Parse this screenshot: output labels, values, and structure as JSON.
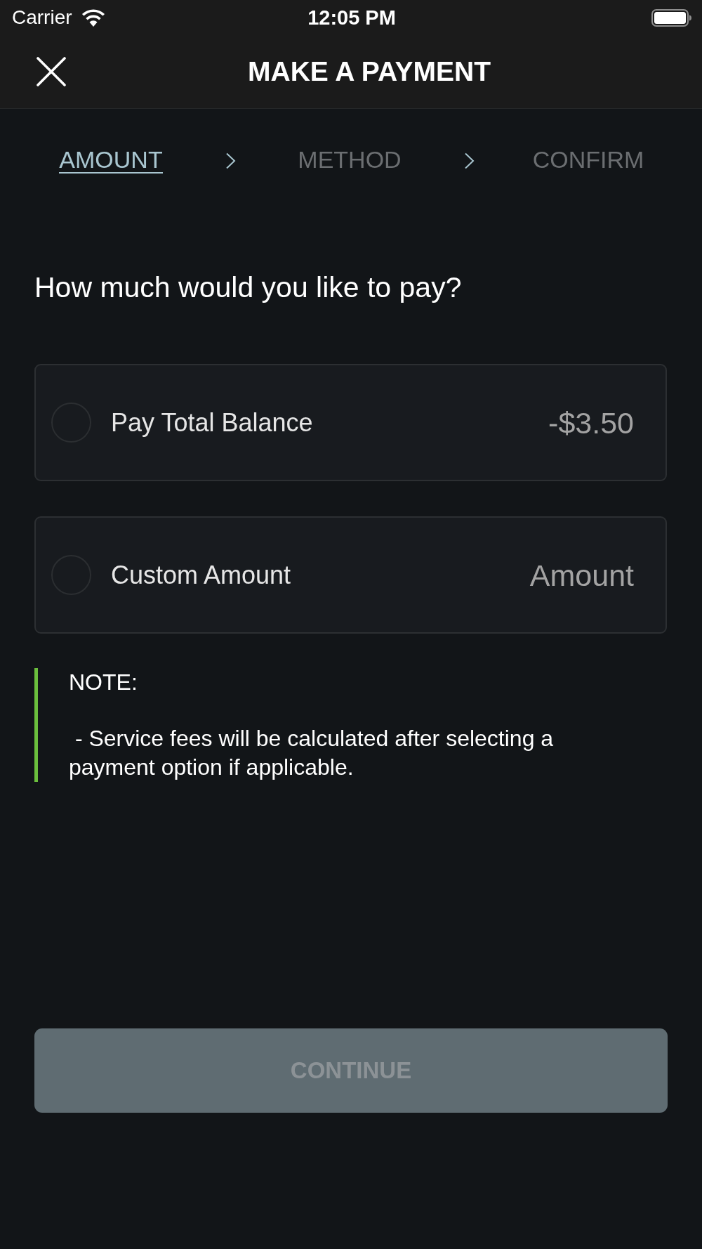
{
  "status_bar": {
    "carrier": "Carrier",
    "time": "12:05 PM"
  },
  "header": {
    "title": "MAKE A PAYMENT"
  },
  "steps": [
    {
      "label": "AMOUNT",
      "selected": true
    },
    {
      "label": "METHOD",
      "selected": false
    },
    {
      "label": "CONFIRM",
      "selected": false
    }
  ],
  "question": "How much would you like to pay?",
  "options": [
    {
      "kind": "fixed",
      "label": "Pay Total Balance",
      "value": "-$3.50",
      "selected": false
    },
    {
      "kind": "custom",
      "label": "Custom Amount",
      "placeholder": "Amount",
      "selected": false
    }
  ],
  "note": {
    "title": "NOTE:",
    "text": " - Service fees will be calculated after selecting a payment option if applicable."
  },
  "continue_button": {
    "label": "CONTINUE",
    "disabled": true
  }
}
